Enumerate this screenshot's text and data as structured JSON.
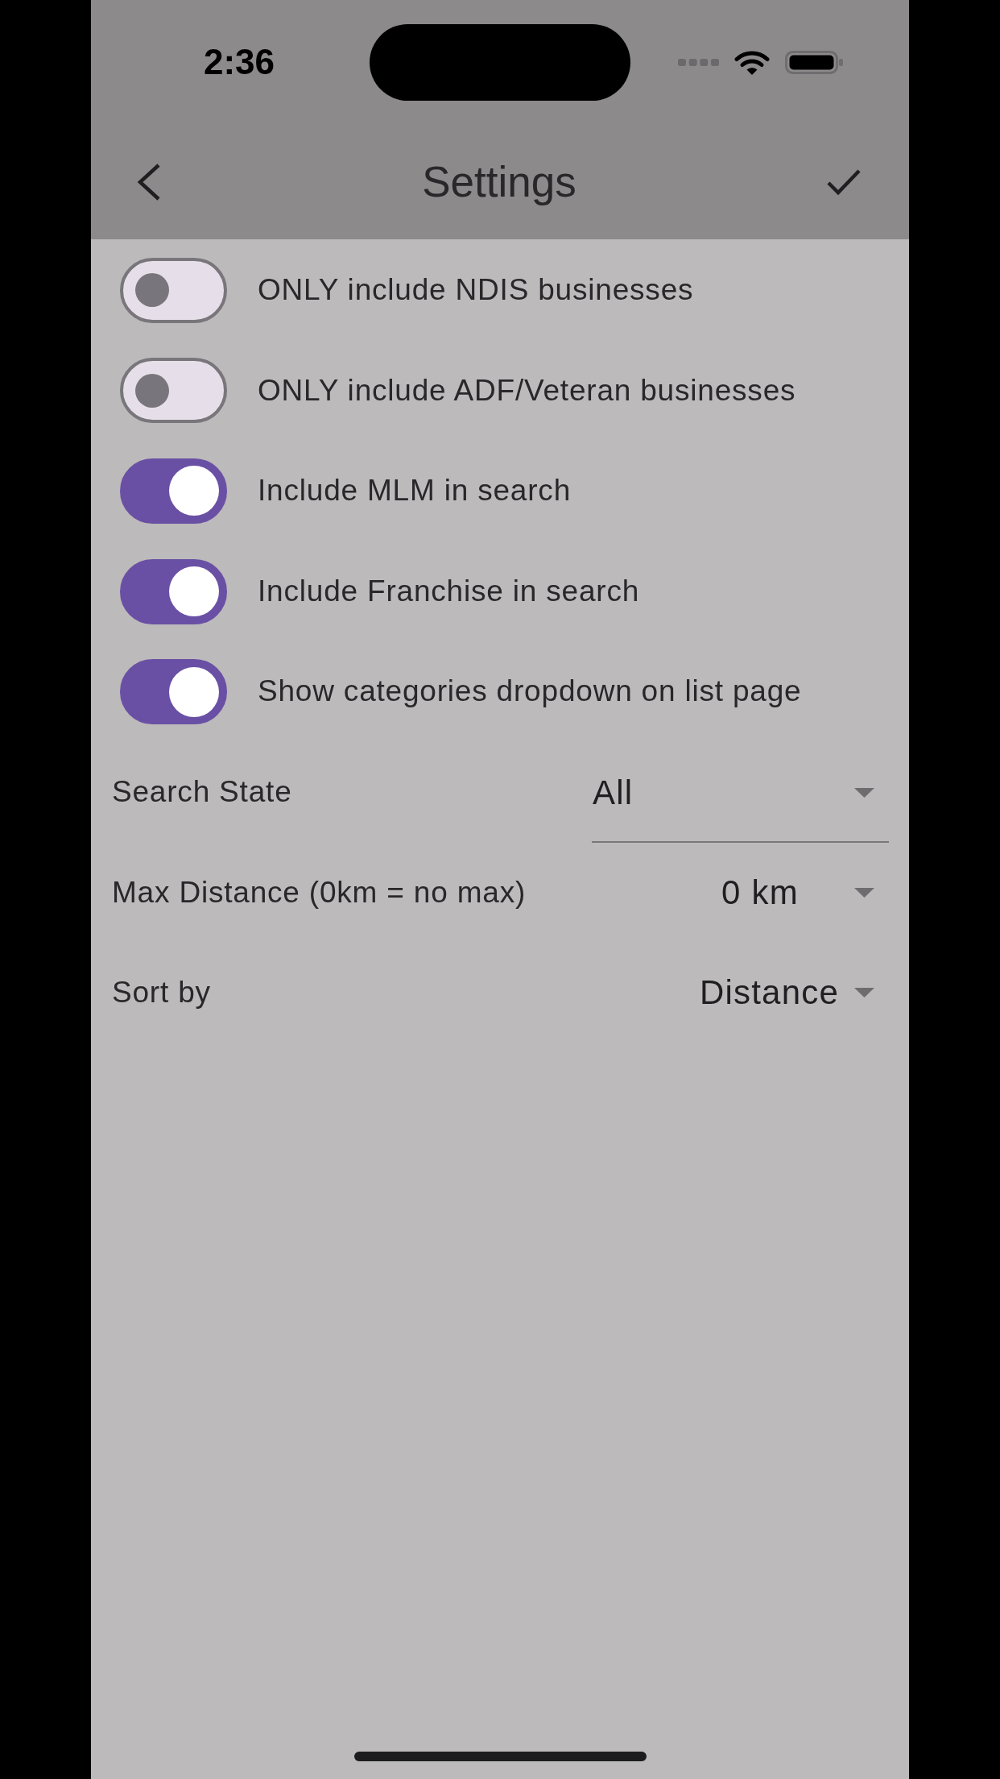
{
  "status_bar": {
    "time": "2:36"
  },
  "nav_bar": {
    "title": "Settings"
  },
  "toggles": [
    {
      "label": "ONLY include NDIS businesses",
      "on": false
    },
    {
      "label": "ONLY include ADF/Veteran businesses",
      "on": false
    },
    {
      "label": "Include MLM in search",
      "on": true
    },
    {
      "label": "Include Franchise in search",
      "on": true
    },
    {
      "label": "Show categories dropdown on list page",
      "on": true
    }
  ],
  "dropdowns": [
    {
      "kind": "field",
      "label": "Search State",
      "value": "All"
    },
    {
      "kind": "inline",
      "label": "Max Distance (0km = no max)",
      "value": "0 km"
    },
    {
      "kind": "inline",
      "label": "Sort by",
      "value": "Distance"
    }
  ]
}
